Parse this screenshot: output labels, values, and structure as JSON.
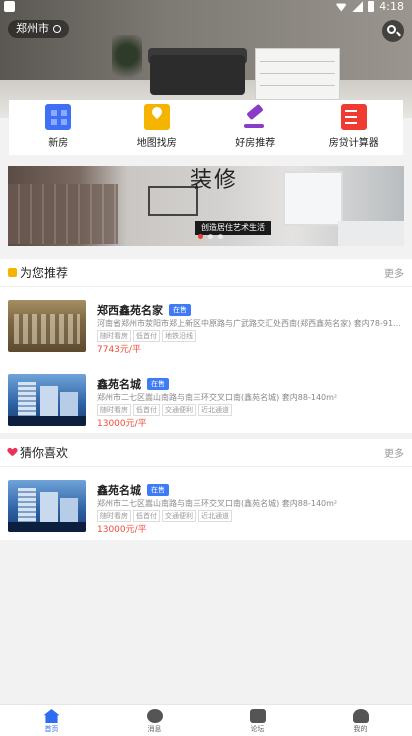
{
  "status_bar": {
    "time": "4:18"
  },
  "header": {
    "city": "郑州市"
  },
  "menu": [
    {
      "label": "新房",
      "icon": "building-icon"
    },
    {
      "label": "地图找房",
      "icon": "map-icon"
    },
    {
      "label": "好房推荐",
      "icon": "gavel-icon"
    },
    {
      "label": "房贷计算器",
      "icon": "calculator-icon"
    }
  ],
  "banner": {
    "title": "装修",
    "tagline": "创造居住艺术生活"
  },
  "recommend": {
    "title": "为您推荐",
    "more": "更多",
    "items": [
      {
        "name": "郑西鑫苑名家",
        "badge": "在售",
        "address": "河南省郑州市荥阳市郑上新区中原路与广武路交汇处西南(郑西鑫苑名家) 套内78-91...",
        "tags": [
          "随时看房",
          "低首付",
          "地铁沿线"
        ],
        "price": "7743元/平"
      },
      {
        "name": "鑫苑名城",
        "badge": "在售",
        "address": "郑州市二七区嵩山南路与南三环交叉口南(鑫苑名城) 套内88-140m²",
        "tags": [
          "随时看房",
          "低首付",
          "交通便利",
          "近北通道"
        ],
        "price": "13000元/平"
      }
    ]
  },
  "guess": {
    "title": "猜你喜欢",
    "more": "更多",
    "items": [
      {
        "name": "鑫苑名城",
        "badge": "在售",
        "address": "郑州市二七区嵩山南路与南三环交叉口南(鑫苑名城) 套内88-140m²",
        "tags": [
          "随时看房",
          "低首付",
          "交通便利",
          "近北通道"
        ],
        "price": "13000元/平"
      }
    ]
  },
  "tabbar": [
    {
      "label": "首页",
      "active": true
    },
    {
      "label": "消息",
      "active": false
    },
    {
      "label": "论坛",
      "active": false
    },
    {
      "label": "我的",
      "active": false
    }
  ]
}
